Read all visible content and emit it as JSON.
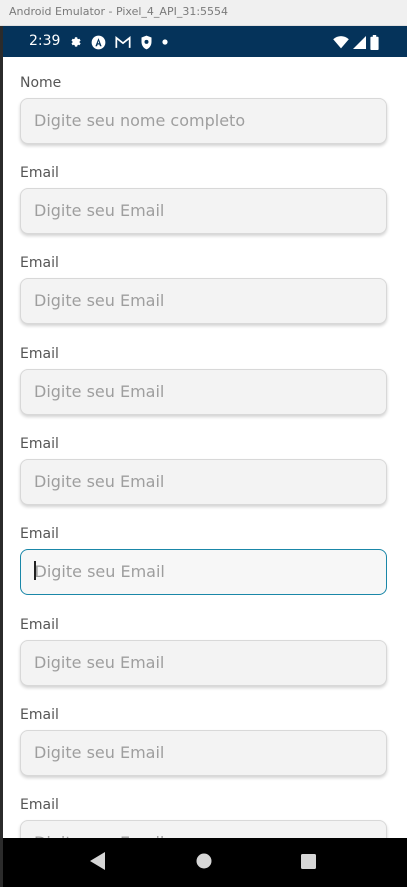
{
  "window": {
    "title": "Android Emulator - Pixel_4_API_31:5554"
  },
  "status_bar": {
    "time": "2:39",
    "left_icons": [
      "settings-icon",
      "autofill-icon",
      "gmail-icon",
      "shield-icon",
      "dot-icon"
    ],
    "right_icons": [
      "wifi-icon",
      "signal-icon",
      "battery-icon"
    ]
  },
  "form": {
    "fields": [
      {
        "label": "Nome",
        "placeholder": "Digite seu nome completo",
        "value": "",
        "focused": false
      },
      {
        "label": "Email",
        "placeholder": "Digite seu Email",
        "value": "",
        "focused": false
      },
      {
        "label": "Email",
        "placeholder": "Digite seu Email",
        "value": "",
        "focused": false
      },
      {
        "label": "Email",
        "placeholder": "Digite seu Email",
        "value": "",
        "focused": false
      },
      {
        "label": "Email",
        "placeholder": "Digite seu Email",
        "value": "",
        "focused": false
      },
      {
        "label": "Email",
        "placeholder": "Digite seu Email",
        "value": "",
        "focused": true
      },
      {
        "label": "Email",
        "placeholder": "Digite seu Email",
        "value": "",
        "focused": false
      },
      {
        "label": "Email",
        "placeholder": "Digite seu Email",
        "value": "",
        "focused": false
      },
      {
        "label": "Email",
        "placeholder": "Digite seu Email",
        "value": "",
        "focused": false
      }
    ]
  },
  "nav_bar": {
    "buttons": [
      "back-icon",
      "home-icon",
      "recents-icon"
    ]
  },
  "colors": {
    "status_bar": "#05335a",
    "focus_border": "#1a87a8",
    "input_bg": "#f3f3f3",
    "placeholder": "#9e9e9e"
  }
}
